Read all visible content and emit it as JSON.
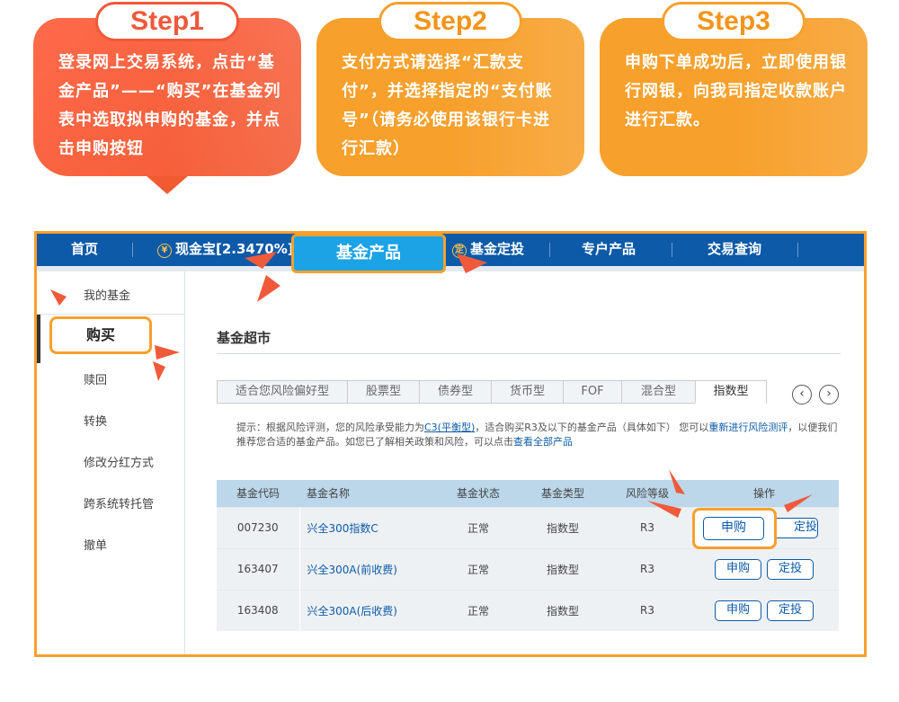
{
  "steps": [
    {
      "label": "Step1",
      "text": "登录网上交易系统，点击“基金产品”——“购买”在基金列表中选取拟申购的基金，并点击申购按钮"
    },
    {
      "label": "Step2",
      "text": "支付方式请选择“汇款支付”，并选择指定的“支付账号”（请务必使用该银行卡进行汇款）"
    },
    {
      "label": "Step3",
      "text": "申购下单成功后，立即使用银行网银，向我司指定收款账户进行汇款。"
    }
  ],
  "nav": {
    "home": "首页",
    "cash": "现金宝[2.3470%]",
    "cash_icon": "¥",
    "fund_products": "基金产品",
    "fixed_invest": "基金定投",
    "fixed_icon": "定",
    "special": "专户产品",
    "query": "交易查询"
  },
  "sidebar": {
    "items": [
      "我的基金",
      "购买",
      "赎回",
      "转换",
      "修改分红方式",
      "跨系统转托管",
      "撤单"
    ]
  },
  "main": {
    "title": "基金超市",
    "tabs": [
      "适合您风险偏好型",
      "股票型",
      "债券型",
      "货币型",
      "FOF",
      "混合型",
      "指数型"
    ],
    "hint_prefix": "提示：根据风险评测，您的风险承受能力为",
    "hint_level": "C3(平衡型)",
    "hint_mid": "，适合购买R3及以下的基金产品（具体如下） 您可以",
    "hint_link1": "重新进行风险测评",
    "hint_mid2": "，以便我们推荐您合适的基金产品。如您已了解相关政策和风险，可以点击",
    "hint_link2": "查看全部产品"
  },
  "table": {
    "headers": [
      "基金代码",
      "基金名称",
      "基金状态",
      "基金类型",
      "风险等级",
      "操作"
    ],
    "rows": [
      [
        "007230",
        "兴全300指数C",
        "正常",
        "指数型",
        "R3"
      ],
      [
        "163407",
        "兴全300A(前收费)",
        "正常",
        "指数型",
        "R3"
      ],
      [
        "163408",
        "兴全300A(后收费)",
        "正常",
        "指数型",
        "R3"
      ]
    ],
    "buy_label": "申购",
    "fixed_label": "定投"
  },
  "colors": {
    "accent_orange": "#f7a02c",
    "step1_red": "#f25a32",
    "nav_blue": "#0c5aa8",
    "active_tab_blue": "#1ba3e6",
    "pointer_red": "#f05a3a"
  }
}
